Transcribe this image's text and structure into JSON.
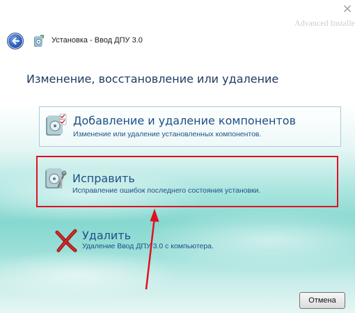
{
  "window": {
    "title": "Установка - Ввод ДПУ 3.0",
    "brand": "Advanced Installer",
    "close_glyph": "×"
  },
  "page_title": "Изменение, восстановление или удаление",
  "options": [
    {
      "title": "Добавление и удаление компонентов",
      "description": "Изменение или удаление установленных компонентов.",
      "icon": "modify-components-icon"
    },
    {
      "title": "Исправить",
      "description": "Исправление ошибок последнего состояния установки.",
      "icon": "repair-icon"
    },
    {
      "title": "Удалить",
      "description": "Удаление Ввод ДПУ 3.0 с компьютера.",
      "icon": "remove-x-icon"
    }
  ],
  "buttons": {
    "cancel": "Отмена"
  },
  "colors": {
    "accent_text": "#1d4f86",
    "highlight": "#e01020",
    "arrow": "#e01020"
  }
}
